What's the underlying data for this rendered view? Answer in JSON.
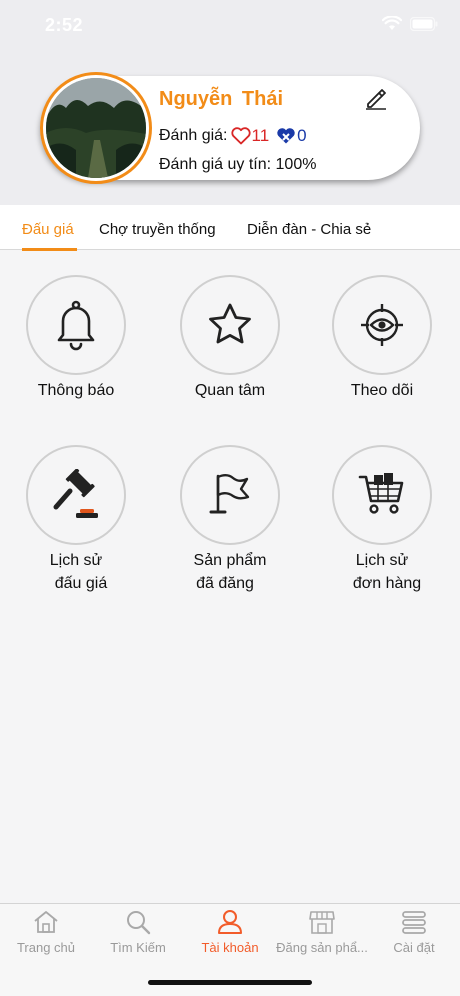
{
  "status_bar": {
    "time": "2:52"
  },
  "profile": {
    "name": "Nguyễn Thái",
    "rating_label": "Đánh giá:",
    "likes": "11",
    "dislikes": "0",
    "trust_text": "Đánh giá uy tín: 100%"
  },
  "tabs": [
    {
      "label": "Đấu giá",
      "active": true
    },
    {
      "label": "Chợ truyền thống",
      "active": false
    },
    {
      "label": "Diễn đàn - Chia sẻ",
      "active": false
    }
  ],
  "menu": [
    {
      "label": "Thông báo",
      "icon": "bell-icon"
    },
    {
      "label": "Quan tâm",
      "icon": "star-icon"
    },
    {
      "label": "Theo dõi",
      "icon": "eye-target-icon"
    },
    {
      "label_line1": "Lịch sử",
      "label_line2": "đấu giá",
      "icon": "gavel-icon"
    },
    {
      "label_line1": "Sản phẩm",
      "label_line2": "đã đăng",
      "icon": "flag-icon"
    },
    {
      "label_line1": "Lịch sử",
      "label_line2": "đơn hàng",
      "icon": "shopping-cart-icon"
    }
  ],
  "tabbar": [
    {
      "label": "Trang chủ",
      "icon": "home-icon",
      "active": false
    },
    {
      "label": "Tìm Kiếm",
      "icon": "search-icon",
      "active": false
    },
    {
      "label": "Tài khoản",
      "icon": "user-icon",
      "active": true
    },
    {
      "label": "Đăng sản phẩ...",
      "icon": "store-icon",
      "active": false
    },
    {
      "label": "Cài đặt",
      "icon": "settings-icon",
      "active": false
    }
  ],
  "colors": {
    "accent": "#f28c18",
    "like": "#d92626",
    "dislike": "#1a3aa8",
    "tabbar_active": "#f25c2a"
  }
}
